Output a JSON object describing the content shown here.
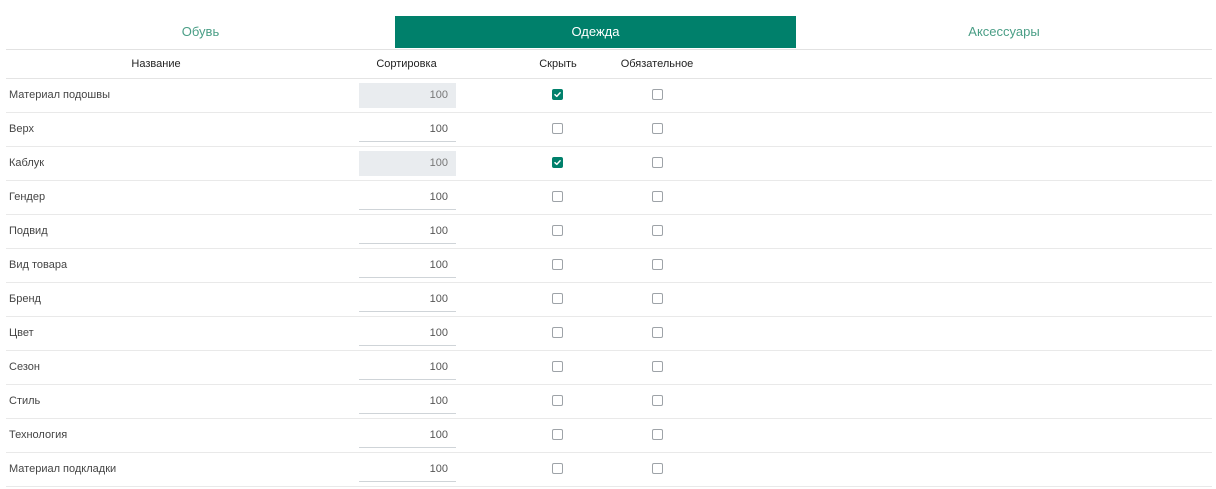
{
  "tabs": [
    {
      "label": "Обувь",
      "active": false
    },
    {
      "label": "Одежда",
      "active": true
    },
    {
      "label": "Аксессуары",
      "active": false
    }
  ],
  "colors": {
    "accent": "#00806b",
    "tab_inactive_text": "#4a9e86",
    "disabled_input_bg": "#e9ecef"
  },
  "table": {
    "headers": {
      "name": "Название",
      "sort": "Сортировка",
      "hide": "Скрыть",
      "required": "Обязательное"
    },
    "rows": [
      {
        "name": "Материал подошвы",
        "sort": "100",
        "sort_disabled": true,
        "hide": true,
        "required": false
      },
      {
        "name": "Верх",
        "sort": "100",
        "sort_disabled": false,
        "hide": false,
        "required": false
      },
      {
        "name": "Каблук",
        "sort": "100",
        "sort_disabled": true,
        "hide": true,
        "required": false
      },
      {
        "name": "Гендер",
        "sort": "100",
        "sort_disabled": false,
        "hide": false,
        "required": false
      },
      {
        "name": "Подвид",
        "sort": "100",
        "sort_disabled": false,
        "hide": false,
        "required": false
      },
      {
        "name": "Вид товара",
        "sort": "100",
        "sort_disabled": false,
        "hide": false,
        "required": false
      },
      {
        "name": "Бренд",
        "sort": "100",
        "sort_disabled": false,
        "hide": false,
        "required": false
      },
      {
        "name": "Цвет",
        "sort": "100",
        "sort_disabled": false,
        "hide": false,
        "required": false
      },
      {
        "name": "Сезон",
        "sort": "100",
        "sort_disabled": false,
        "hide": false,
        "required": false
      },
      {
        "name": "Стиль",
        "sort": "100",
        "sort_disabled": false,
        "hide": false,
        "required": false
      },
      {
        "name": "Технология",
        "sort": "100",
        "sort_disabled": false,
        "hide": false,
        "required": false
      },
      {
        "name": "Материал подкладки",
        "sort": "100",
        "sort_disabled": false,
        "hide": false,
        "required": false
      }
    ]
  }
}
